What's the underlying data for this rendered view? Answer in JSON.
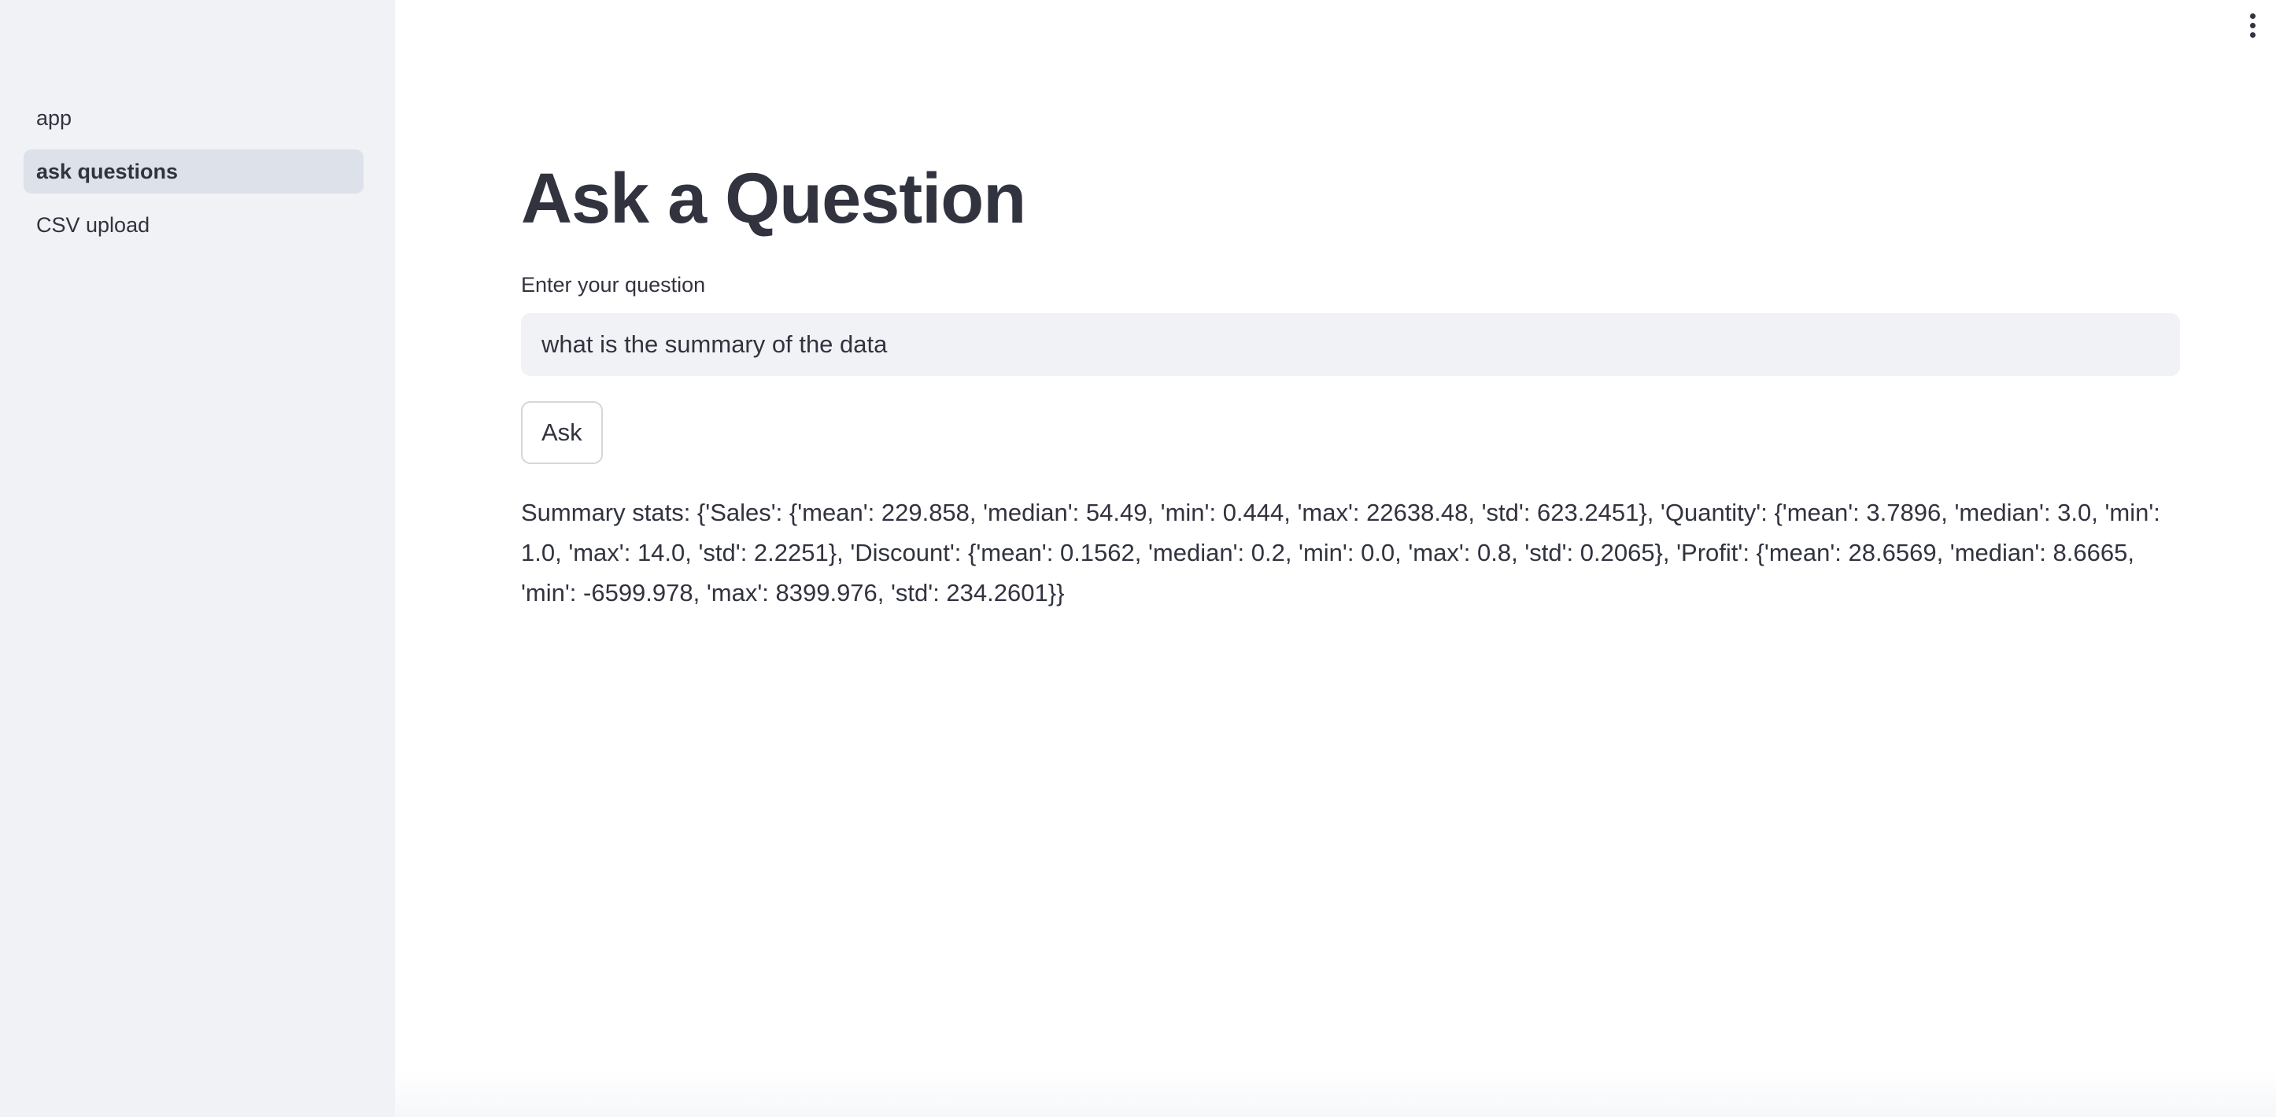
{
  "sidebar": {
    "items": [
      {
        "label": "app",
        "active": false
      },
      {
        "label": "ask questions",
        "active": true
      },
      {
        "label": "CSV upload",
        "active": false
      }
    ]
  },
  "header": {
    "menu_icon": "vertical-ellipsis-icon"
  },
  "main": {
    "title": "Ask a Question",
    "question_label": "Enter your question",
    "question_value": "what is the summary of the data",
    "ask_button_label": "Ask",
    "answer_text": "Summary stats: {'Sales': {'mean': 229.858, 'median': 54.49, 'min': 0.444, 'max': 22638.48, 'std': 623.2451}, 'Quantity': {'mean': 3.7896, 'median': 3.0, 'min': 1.0, 'max': 14.0, 'std': 2.2251}, 'Discount': {'mean': 0.1562, 'median': 0.2, 'min': 0.0, 'max': 0.8, 'std': 0.2065}, 'Profit': {'mean': 28.6569, 'median': 8.6665, 'min': -6599.978, 'max': 8399.976, 'std': 234.2601}}"
  },
  "colors": {
    "sidebar_bg": "#f0f2f6",
    "active_item_bg": "#dde1ea",
    "text": "#31333f",
    "input_bg": "#f0f2f6",
    "button_border": "#d3d6dc"
  }
}
